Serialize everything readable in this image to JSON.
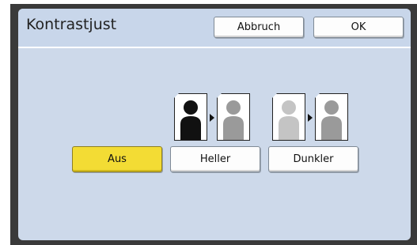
{
  "dialog": {
    "title": "Kontrastjust",
    "cancel_label": "Abbruch",
    "ok_label": "OK"
  },
  "options": [
    {
      "label": "Aus",
      "selected": true
    },
    {
      "label": "Heller",
      "selected": false
    },
    {
      "label": "Dunkler",
      "selected": false
    }
  ],
  "illustrations": {
    "heller": {
      "from_figure_color": "#111111",
      "to_figure_color": "#9a9a9a"
    },
    "dunkler": {
      "from_figure_color": "#c4c4c4",
      "to_figure_color": "#9a9a9a"
    }
  },
  "colors": {
    "selected": "#f3dc34",
    "panel": "#cdd9ea"
  }
}
